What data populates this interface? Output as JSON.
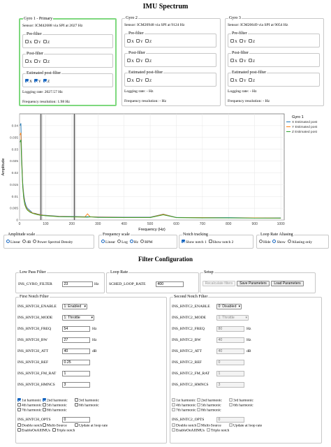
{
  "page_title": "IMU Spectrum",
  "gyros": [
    {
      "title": "Gyro 1 - Primary",
      "sensor": "Sensor: ICM42688 via SPI at 2027 Hz",
      "pre": "Pre-filter",
      "post": "Post-filter",
      "est": "Estimated post-filter",
      "logging": "Logging rate: 2027.57 Hz",
      "freq": "Frequency resolution: 1.98 Hz"
    },
    {
      "title": "Gyro 2",
      "sensor": "Sensor: ICM20948 via SPI at 9124 Hz",
      "pre": "Pre-filter",
      "post": "Post-filter",
      "est": "Estimated post-filter",
      "logging": "Logging rate: - Hz",
      "freq": "Frequency resolution: - Hz"
    },
    {
      "title": "Gyro 3",
      "sensor": "Sensor: ICM20649 via SPI at 9054 Hz",
      "pre": "Pre-filter",
      "post": "Post-filter",
      "est": "Estimated post-filter",
      "logging": "Logging rate: - Hz",
      "freq": "Frequency resolution: - Hz"
    }
  ],
  "axes": {
    "x": "X",
    "y": "Y",
    "z": "Z"
  },
  "plot": {
    "ylabel": "Amplitude",
    "xlabel": "Frequency (Hz)",
    "legend_title": "Gyro 1",
    "legend": [
      "X Estimated post",
      "Y Estimated post",
      "Z Estimated post"
    ]
  },
  "chart_data": {
    "type": "line",
    "title": "",
    "xlabel": "Frequency (Hz)",
    "ylabel": "Amplitude",
    "xlim": [
      0,
      1013
    ],
    "ylim": [
      0,
      0.045
    ],
    "x_ticks": [
      "0",
      "100",
      "200",
      "300",
      "400",
      "500",
      "600",
      "700",
      "800",
      "900",
      "1000"
    ],
    "y_ticks": [
      "0",
      "0.005",
      "0.01",
      "0.015",
      "0.02",
      "0.025",
      "0.03",
      "0.035",
      "0.04"
    ],
    "legend_title": "Gyro 1",
    "x": [
      2,
      5,
      8,
      12,
      16,
      20,
      25,
      30,
      40,
      50,
      60,
      70,
      80,
      90,
      100,
      150,
      200,
      250,
      260,
      270,
      300,
      400,
      500,
      550,
      600,
      700,
      800,
      900,
      1000
    ],
    "series": [
      {
        "name": "X Estimated post",
        "color": "#1f77b4",
        "values": [
          0.04,
          0.041,
          0.028,
          0.016,
          0.011,
          0.008,
          0.006,
          0.005,
          0.004,
          0.003,
          0.0028,
          0.0025,
          0.0023,
          0.0021,
          0.002,
          0.0016,
          0.0015,
          0.0014,
          0.0014,
          0.0014,
          0.0013,
          0.0012,
          0.0012,
          0.0025,
          0.0011,
          0.001,
          0.001,
          0.0009,
          0.0009
        ]
      },
      {
        "name": "Y Estimated post",
        "color": "#ff7f0e",
        "values": [
          0.036,
          0.037,
          0.026,
          0.015,
          0.01,
          0.007,
          0.0055,
          0.0045,
          0.0035,
          0.003,
          0.0027,
          0.0024,
          0.0022,
          0.002,
          0.0019,
          0.0015,
          0.0014,
          0.0013,
          0.0026,
          0.0014,
          0.0012,
          0.0011,
          0.0011,
          0.0024,
          0.001,
          0.001,
          0.0009,
          0.0009,
          0.0008
        ]
      },
      {
        "name": "Z Estimated post",
        "color": "#2ca02c",
        "values": [
          0.033,
          0.034,
          0.024,
          0.014,
          0.009,
          0.0065,
          0.005,
          0.0042,
          0.0033,
          0.0028,
          0.0025,
          0.0022,
          0.002,
          0.0019,
          0.0018,
          0.0014,
          0.0013,
          0.0012,
          0.0012,
          0.0013,
          0.0011,
          0.001,
          0.001,
          0.0022,
          0.001,
          0.0009,
          0.0009,
          0.0008,
          0.0008
        ]
      }
    ],
    "vertical_markers": [
      {
        "x": 82
      },
      {
        "x": 210
      }
    ],
    "grid": true,
    "legend_position": "right"
  },
  "amp_scale": {
    "title": "Amplitude scale",
    "options": [
      "Linear",
      "dB",
      "Power Spectral Density"
    ],
    "selected": 0
  },
  "freq_scale": {
    "title": "Frequency scale",
    "options": [
      "Linear",
      "Log",
      "Hz",
      "RPM"
    ],
    "selected": [
      0,
      2
    ]
  },
  "notch_tracking": {
    "title": "Notch tracking",
    "options": [
      "Show notch 1",
      "Show notch 2"
    ],
    "checked": [
      true,
      false
    ]
  },
  "loop_aliasing": {
    "title": "Loop Rate Aliasing",
    "options": [
      "Hide",
      "Show",
      "Aliasing only"
    ],
    "selected": 1
  },
  "filter_config_title": "Filter Configuration",
  "lpf": {
    "title": "Low Pass Filter",
    "param": "INS_GYRO_FILTER",
    "value": "23",
    "unit": "Hz"
  },
  "loop_rate": {
    "title": "Loop Rate",
    "param": "SCHED_LOOP_RATE",
    "value": "400"
  },
  "setup": {
    "title": "Setup",
    "recalc": "Recalculate filters",
    "save": "Save Parameters",
    "load": "Load Parameters"
  },
  "notch1": {
    "title": "First Notch Filter",
    "params": [
      {
        "name": "INS_HNTCH_ENABLE",
        "value": "1: Enabled",
        "type": "select",
        "unit": ""
      },
      {
        "name": "INS_HNTCH_MODE",
        "value": "1: Throttle",
        "type": "select",
        "unit": ""
      },
      {
        "name": "INS_HNTCH_FREQ",
        "value": "54",
        "type": "input",
        "unit": "Hz"
      },
      {
        "name": "INS_HNTCH_BW",
        "value": "27",
        "type": "input",
        "unit": "Hz"
      },
      {
        "name": "INS_HNTCH_ATT",
        "value": "40",
        "type": "input",
        "unit": "dB"
      },
      {
        "name": "INS_HNTCH_REF",
        "value": "0.25",
        "type": "input",
        "unit": ""
      },
      {
        "name": "INS_HNTCH_FM_RAT",
        "value": "1",
        "type": "input",
        "unit": ""
      },
      {
        "name": "INS_HNTCH_HMNCS",
        "value": "3",
        "type": "input",
        "unit": ""
      }
    ],
    "harmonics": [
      "1st harmonic",
      "2nd harmonic",
      "3rd harmonic",
      "4th harmonic",
      "5th harmonic",
      "6th harmonic",
      "7th harmonic",
      "8th harmonic"
    ],
    "harm_checked": [
      true,
      true,
      false,
      false,
      false,
      false,
      false,
      false
    ],
    "opts_name": "INS_HNTCH_OPTS",
    "opts_value": "0",
    "opts": [
      "Double notch",
      "Multi-Source",
      "Update at loop rate",
      "EnableOnAllIMUs",
      "Triple notch"
    ]
  },
  "notch2": {
    "title": "Second Notch Filter",
    "params": [
      {
        "name": "INS_HNTC2_ENABLE",
        "value": "0: Disabled",
        "type": "select",
        "unit": ""
      },
      {
        "name": "INS_HNTC2_MODE",
        "value": "1: Throttle",
        "type": "select",
        "unit": ""
      },
      {
        "name": "INS_HNTC2_FREQ",
        "value": "80",
        "type": "input",
        "unit": "Hz"
      },
      {
        "name": "INS_HNTC2_BW",
        "value": "40",
        "type": "input",
        "unit": "Hz"
      },
      {
        "name": "INS_HNTC2_ATT",
        "value": "40",
        "type": "input",
        "unit": "dB"
      },
      {
        "name": "INS_HNTC2_REF",
        "value": "0",
        "type": "input",
        "unit": ""
      },
      {
        "name": "INS_HNTC2_FM_RAT",
        "value": "1",
        "type": "input",
        "unit": ""
      },
      {
        "name": "INS_HNTC2_HMNCS",
        "value": "3",
        "type": "input",
        "unit": ""
      }
    ],
    "harmonics": [
      "1st harmonic",
      "2nd harmonic",
      "3rd harmonic",
      "4th harmonic",
      "5th harmonic",
      "6th harmonic",
      "7th harmonic",
      "8th harmonic"
    ],
    "harm_checked": [
      false,
      false,
      false,
      false,
      false,
      false,
      false,
      false
    ],
    "opts_name": "INS_HNTC2_OPTS",
    "opts_value": "0",
    "opts": [
      "Double notch",
      "Multi-Source",
      "Update at loop rate",
      "EnableOnAllIMUs",
      "Triple notch"
    ]
  }
}
